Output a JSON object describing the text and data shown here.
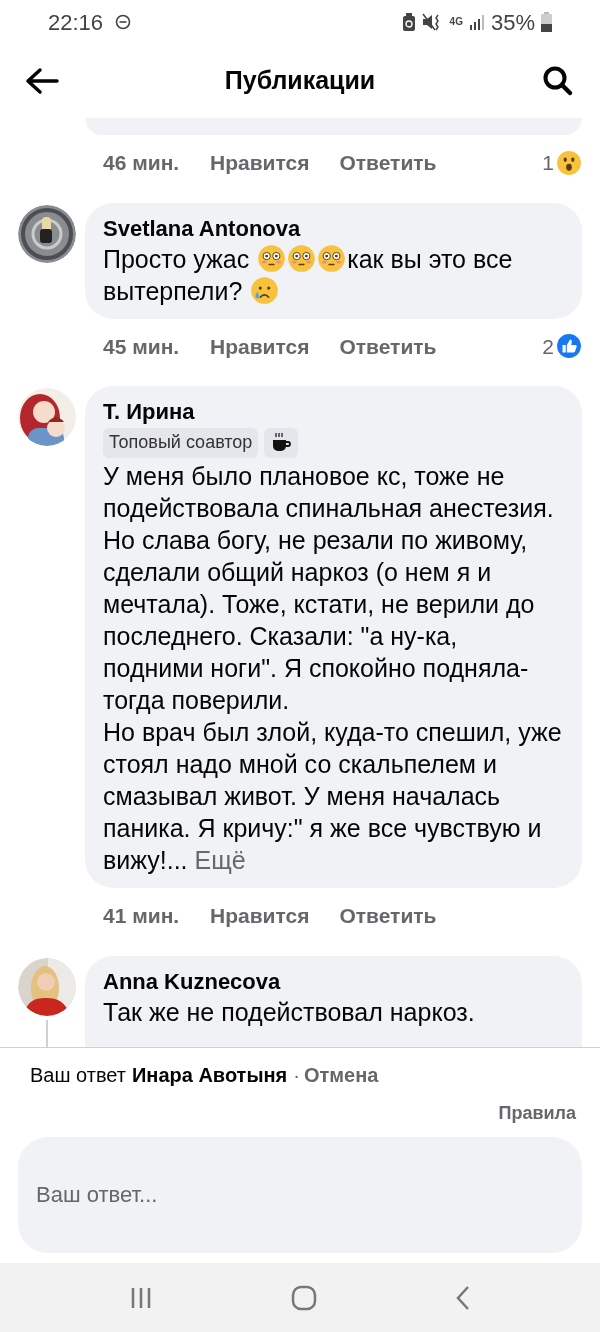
{
  "status_bar": {
    "time": "22:16",
    "network": "4G",
    "battery": "35%"
  },
  "header": {
    "title": "Публикации"
  },
  "previous_comment": {
    "time": "46 мин.",
    "like": "Нравится",
    "reply": "Ответить",
    "reactions": {
      "count": "1",
      "kind": "wow"
    }
  },
  "comments": [
    {
      "author": "Svetlana Antonova",
      "body": [
        {
          "kind": "text",
          "text": "Просто ужас"
        },
        {
          "kind": "flushed"
        },
        {
          "kind": "flushed"
        },
        {
          "kind": "flushed"
        },
        {
          "kind": "text",
          "text": "как вы это все"
        },
        {
          "kind": "text",
          "text": "вытерпели?"
        },
        {
          "kind": "crying"
        }
      ],
      "time": "45 мин.",
      "like": "Нравится",
      "reply": "Ответить",
      "reactions": {
        "count": "2",
        "kind": "like"
      },
      "has_replies": false
    },
    {
      "author": "Т. Ирина",
      "badges": [
        {
          "kind": "label",
          "text": "Топовый соавтор"
        },
        {
          "kind": "cup"
        }
      ],
      "body": [
        {
          "kind": "text",
          "text": "У меня было плановое кс, тоже не подействовала спинальная анестезия. Но слава богу, не резали по живому, сделали общий наркоз (о нем я и мечтала). Тоже, кстати, не верили до последнего. Сказали: \"а ну-ка, подними ноги\". Я спокойно подняла-тогда поверили.\nНо врач был злой, куда-то спешил, уже стоял надо мной со скальпелем и смазывал живот. У меня началась паника. Я кричу:\" я же все чувствую и вижу!..."
        }
      ],
      "more": "Ещё",
      "time": "41 мин.",
      "like": "Нравится",
      "reply": "Ответить",
      "has_replies": false
    },
    {
      "author": "Anna Kuznecova",
      "body": [
        {
          "kind": "text",
          "text": "Так же не подействовал наркоз."
        }
      ],
      "has_replies": true
    }
  ],
  "reply_bar": {
    "prefix": "Ваш ответ",
    "name": "Инара Авотыня",
    "separator": "·",
    "cancel": "Отмена",
    "rules": "Правила",
    "placeholder": "Ваш ответ..."
  }
}
